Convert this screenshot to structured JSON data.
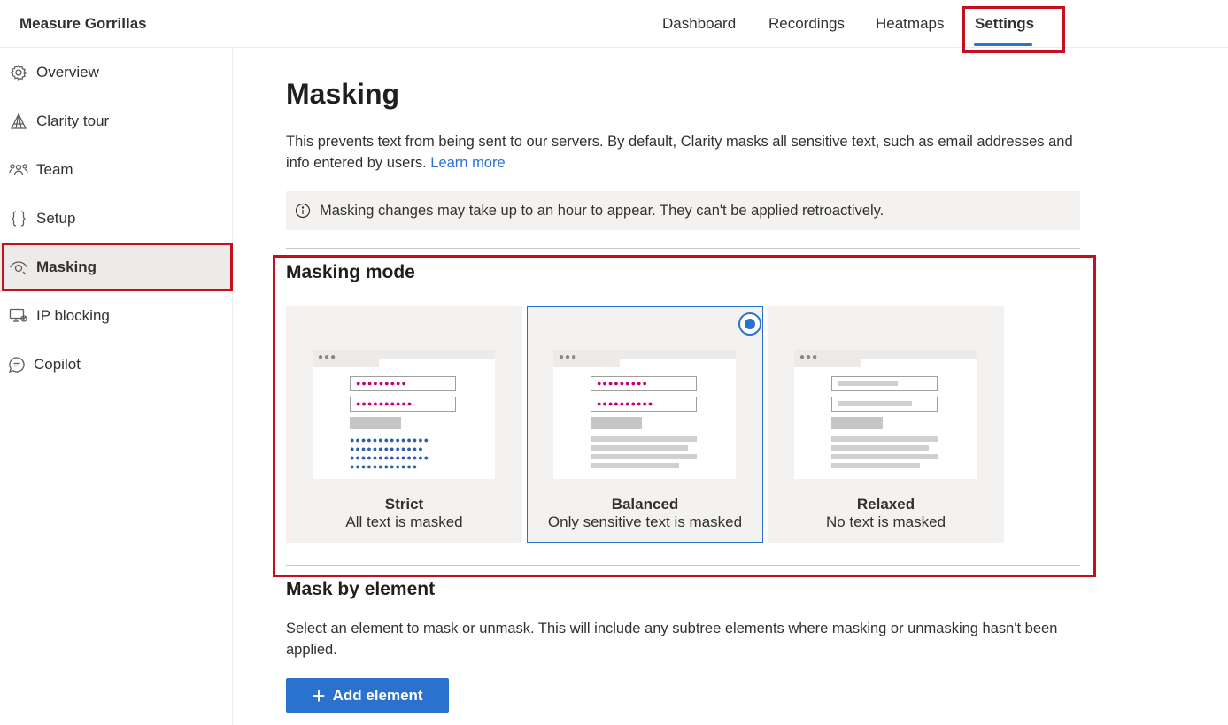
{
  "header": {
    "project_name": "Measure Gorrillas",
    "tabs": [
      {
        "label": "Dashboard"
      },
      {
        "label": "Recordings"
      },
      {
        "label": "Heatmaps"
      },
      {
        "label": "Settings"
      }
    ],
    "active_tab": "Settings"
  },
  "sidebar": {
    "items": [
      {
        "label": "Overview",
        "icon": "gear-icon"
      },
      {
        "label": "Clarity tour",
        "icon": "tour-icon"
      },
      {
        "label": "Team",
        "icon": "team-icon"
      },
      {
        "label": "Setup",
        "icon": "braces-icon"
      },
      {
        "label": "Masking",
        "icon": "eye-icon"
      },
      {
        "label": "IP blocking",
        "icon": "ip-block-icon"
      },
      {
        "label": "Copilot",
        "icon": "chat-icon"
      }
    ],
    "active_item": "Masking"
  },
  "main": {
    "title": "Masking",
    "description": "This prevents text from being sent to our servers. By default, Clarity masks all sensitive text, such as email addresses and info entered by users.",
    "learn_more": "Learn more",
    "info_message": "Masking changes may take up to an hour to appear. They can't be applied retroactively.",
    "masking_mode": {
      "title": "Masking mode",
      "options": [
        {
          "name": "Strict",
          "description": "All text is masked"
        },
        {
          "name": "Balanced",
          "description": "Only sensitive text is masked"
        },
        {
          "name": "Relaxed",
          "description": "No text is masked"
        }
      ],
      "selected": "Balanced"
    },
    "mask_by_element": {
      "title": "Mask by element",
      "description": "Select an element to mask or unmask. This will include any subtree elements where masking or unmasking hasn't been applied.",
      "add_button": "Add element"
    }
  },
  "colors": {
    "accent": "#2b72cf",
    "highlight": "#c50f1f",
    "mask_pink": "#c4007a",
    "mask_blue": "#2b5fad"
  }
}
